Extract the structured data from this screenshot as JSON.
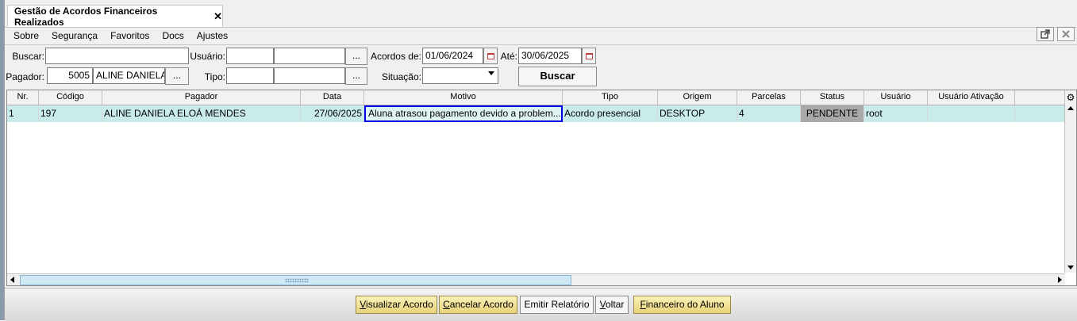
{
  "tab": {
    "title": "Gestão de Acordos Financeiros Realizados",
    "close": "✕"
  },
  "menu": [
    "Sobre",
    "Segurança",
    "Favoritos",
    "Docs",
    "Ajustes"
  ],
  "filters": {
    "buscar_label": "Buscar:",
    "buscar_value": "",
    "usuario_label": "Usuário:",
    "usuario_code": "",
    "usuario_name": "",
    "usuario_button": "...",
    "acordos_de_label": "Acordos de:",
    "acordos_de_value": "01/06/2024",
    "ate_label": "Até:",
    "ate_value": "30/06/2025",
    "pagador_label": "Pagador:",
    "pagador_code": "5005",
    "pagador_name": "ALINE DANIELA",
    "pagador_button": "...",
    "tipo_label": "Tipo:",
    "tipo_code": "",
    "tipo_name": "",
    "tipo_button": "...",
    "situacao_label": "Situação:",
    "situacao_value": "",
    "buscar_button": "Buscar"
  },
  "table": {
    "columns": [
      "Nr.",
      "Código",
      "Pagador",
      "Data",
      "Motivo",
      "Tipo",
      "Origem",
      "Parcelas",
      "Status",
      "Usuário",
      "Usuário Ativação",
      ""
    ],
    "rows": [
      {
        "nr": "1",
        "codigo": "197",
        "pagador": "ALINE DANIELA ELOÁ MENDES",
        "data": "27/06/2025",
        "motivo": "Aluna atrasou pagamento devido a problem...",
        "tipo": "Acordo presencial",
        "origem": "DESKTOP",
        "parcelas": "4",
        "status": "PENDENTE",
        "usuario": "root",
        "usuario_ativacao": ""
      }
    ]
  },
  "footer": {
    "visualizar": {
      "mnemonic": "V",
      "rest": "isualizar Acordo"
    },
    "cancelar": {
      "mnemonic": "C",
      "rest": "ancelar Acordo"
    },
    "emitir": "Emitir Relatório",
    "voltar": {
      "mnemonic": "V",
      "rest": "oltar"
    },
    "financeiro": {
      "mnemonic": "F",
      "rest": "inanceiro do Aluno"
    }
  },
  "colors": {
    "selected_row": "#c9eceb",
    "selected_cell_border": "#0000e0",
    "status_bg": "#a9a9a9",
    "yellow_button": "#f3e399"
  },
  "icons": [
    "close-icon",
    "popout-icon",
    "window-close-icon",
    "calendar-icon",
    "dropdown-arrow-icon",
    "gear-icon",
    "scroll-left-icon",
    "scroll-right-icon",
    "scroll-up-icon",
    "scroll-down-icon"
  ]
}
